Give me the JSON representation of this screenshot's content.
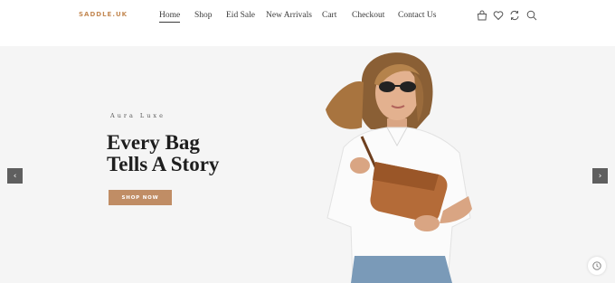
{
  "header": {
    "logo": "SADDLE.UK",
    "nav": [
      "Home",
      "Shop",
      "Eid Sale",
      "New Arrivals",
      "Cart",
      "Checkout",
      "Contact Us"
    ],
    "active_nav": "Home",
    "icons": [
      "bag-icon",
      "heart-icon",
      "compare-icon",
      "search-icon"
    ]
  },
  "hero": {
    "eyebrow": "Aura Luxe",
    "headline_line1": "Every Bag",
    "headline_line2": "Tells A Story",
    "cta": "SHOP NOW",
    "prev_arrow": "‹",
    "next_arrow": "›"
  },
  "colors": {
    "accent": "#c08d65",
    "logo": "#c48a55",
    "hero_bg": "#f5f5f5",
    "arrow_bg": "#5f5f5f"
  }
}
